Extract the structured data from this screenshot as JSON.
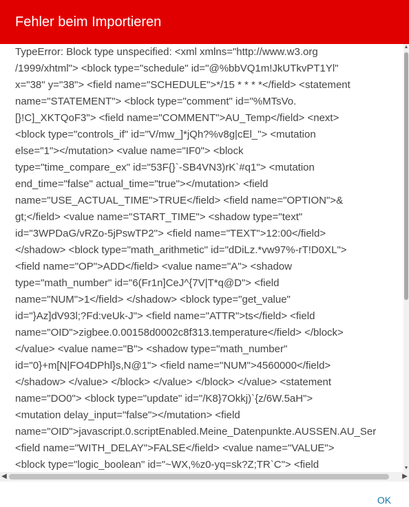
{
  "dialog": {
    "title": "Fehler beim Importieren",
    "header_color": "#e10000",
    "accent_color": "#1976a8",
    "ok_label": "OK"
  },
  "error_lines": [
    "TypeError: Block type unspecified: <xml xmlns=\"http://www.w3.org",
    "/1999/xhtml\"> <block type=\"schedule\" id=\"@%bbVQ1m!JkUTkvPT1Yl\"",
    "x=\"38\" y=\"38\"> <field name=\"SCHEDULE\">*/15 * * * *</field> <statement",
    "name=\"STATEMENT\"> <block type=\"comment\" id=\"%MTsVo.",
    "[}!C]_XKTQoF3\"> <field name=\"COMMENT\">AU_Temp</field> <next>",
    "<block type=\"controls_if\" id=\"V/mw_]*jQh?%v8g|cEl_\"> <mutation",
    "else=\"1\"></mutation> <value name=\"IF0\"> <block",
    "type=\"time_compare_ex\" id=\"53F{}`-SB4VN3)rK`#q1\"> <mutation",
    "end_time=\"false\" actual_time=\"true\"></mutation> <field",
    "name=\"USE_ACTUAL_TIME\">TRUE</field> <field name=\"OPTION\">&",
    "gt;</field> <value name=\"START_TIME\"> <shadow type=\"text\"",
    "id=\"3WPDaG/vRZo-5jPswTP2\"> <field name=\"TEXT\">12:00</field>",
    "</shadow> <block type=\"math_arithmetic\" id=\"dDiLz.*vw97%-rT!D0XL\">",
    "<field name=\"OP\">ADD</field> <value name=\"A\"> <shadow",
    "type=\"math_number\" id=\"6(Fr1n]CeJ^{7V|T*q@D\"> <field",
    "name=\"NUM\">1</field> </shadow> <block type=\"get_value\"",
    "id=\"}Az]dV93l;?Fd:veUk-J\"> <field name=\"ATTR\">ts</field> <field",
    "name=\"OID\">zigbee.0.00158d0002c8f313.temperature</field> </block>",
    "</value> <value name=\"B\"> <shadow type=\"math_number\"",
    "id=\"0}+m[N|FO4DPhl}s,N@1\"> <field name=\"NUM\">4560000</field>",
    "</shadow> </value> </block> </value> </block> </value> <statement",
    "name=\"DO0\"> <block type=\"update\" id=\"/K8}7Okkj)`{z/6W.5aH\">",
    "<mutation delay_input=\"false\"></mutation> <field",
    "name=\"OID\">javascript.0.scriptEnabled.Meine_Datenpunkte.AUSSEN.AU_Ser",
    "<field name=\"WITH_DELAY\">FALSE</field> <value name=\"VALUE\">",
    "<block type=\"logic_boolean\" id=\"~WX,%z0-yq=sk?Z;TR`C\"> <field"
  ],
  "scrollbars": {
    "up_arrow": "▲",
    "down_arrow": "▼",
    "left_arrow": "◀",
    "right_arrow": "▶"
  }
}
